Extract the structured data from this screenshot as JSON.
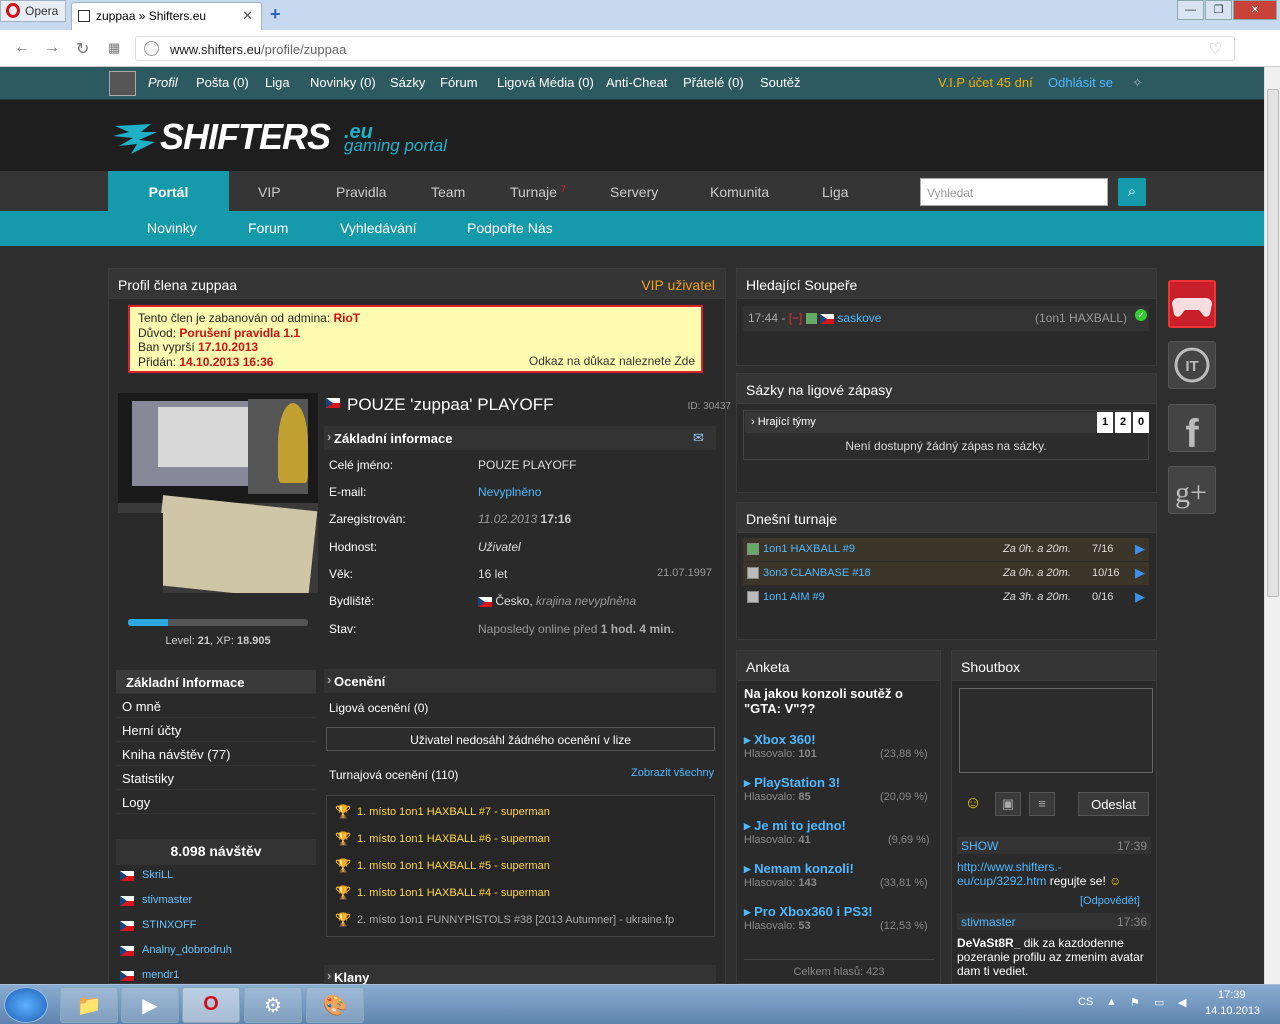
{
  "browser": {
    "menu_label": "Opera",
    "tab_title": "zuppaa » Shifters.eu",
    "url_host": "www.shifters.eu",
    "url_path": "/profile/zuppaa"
  },
  "topbar": {
    "items": [
      "Profil",
      "Pošta (0)",
      "Liga",
      "Novinky (0)",
      "Sázky",
      "Fórum",
      "Ligová Média (0)",
      "Anti-Cheat",
      "Přátelé (0)",
      "Soutěž"
    ],
    "vip": "V.I.P účet",
    "vip_days": "45 dní",
    "logout": "Odhlásit se"
  },
  "logo": {
    "text": "SHIFTERS",
    "eu": ".eu",
    "sub": "gaming portal"
  },
  "mainnav": {
    "items": [
      "Portál",
      "VIP",
      "Pravidla",
      "Team",
      "Turnaje",
      "Servery",
      "Komunita",
      "Liga"
    ],
    "turnaje_badge": "7",
    "search_placeholder": "Vyhledat"
  },
  "subnav": {
    "items": [
      "Novinky",
      "Forum",
      "Vyhledávání",
      "Podpořte Nás"
    ]
  },
  "profile": {
    "panel_title": "Profil člena zuppaa",
    "vip_badge": "VIP uživatel",
    "ban": {
      "l1": "Tento člen je zabanován od admina: ",
      "admin": "RioT",
      "l2": "Důvod: ",
      "reason": "Porušení pravidla 1.1",
      "l3": "Ban vyprší ",
      "expires": "17.10.2013",
      "l4": "Přidán: ",
      "added": "14.10.2013 16:36",
      "proof": "Odkaz na důkaz naleznete Zde"
    },
    "name": "POUZE 'zuppaa' PLAYOFF",
    "id": "ID: 30437",
    "xp_fraction": 0.22,
    "level_label": "Level: ",
    "level": "21",
    "xp_label": ", XP: ",
    "xp": "18.905",
    "sections": {
      "basic": "Základní informace",
      "awards": "Ocenění",
      "clans": "Klany"
    },
    "info": [
      {
        "label": "Celé jméno:",
        "value": "POUZE PLAYOFF"
      },
      {
        "label": "E-mail:",
        "value": "Nevyplněno"
      },
      {
        "label": "Zaregistrován:",
        "value": "11.02.2013",
        "value2": "17:16"
      },
      {
        "label": "Hodnost:",
        "value": "Uživatel"
      },
      {
        "label": "Věk:",
        "value": "16 let",
        "value2": "21.07.1997"
      },
      {
        "label": "Bydliště:",
        "value": "Česko,",
        "value2": "krajina nevyplněna"
      },
      {
        "label": "Stav:",
        "value": "Naposledy online před",
        "value2": "1 hod. 4 min."
      }
    ],
    "menu": [
      "Základní Informace",
      "O mně",
      "Herní účty",
      "Kniha návštěv (77)",
      "Statistiky",
      "Logy"
    ],
    "visits": "8.098 návštěv",
    "visitors": [
      "SkriLL",
      "stivmaster",
      "STINXOFF",
      "Analny_dobrodruh",
      "mendr1"
    ],
    "league_awards": "Ligová ocenění (0)",
    "no_award": "Uživatel nedosáhl žádného ocenění v lize",
    "tourney_awards": "Turnajová ocenění (110)",
    "show_all": "Zobrazit všechny",
    "awards": [
      "1. místo 1on1 HAXBALL #7 - superman",
      "1. místo 1on1 HAXBALL #6 - superman",
      "1. místo 1on1 HAXBALL #5 - superman",
      "1. místo 1on1 HAXBALL #4 - superman",
      "2. místo 1on1 FUNNYPISTOLS #38 [2013 Autumner] - ukraine.fp"
    ]
  },
  "opponents": {
    "title": "Hledající Soupeře",
    "time": "17:44 - ",
    "minus": "[−]",
    "user": "saskove",
    "game": "(1on1 HAXBALL)"
  },
  "bets": {
    "title": "Sázky na ligové zápasy",
    "head": "Hrající týmy",
    "n1": "1",
    "n2": "2",
    "n3": "0",
    "empty": "Není dostupný žádný zápas na sázky."
  },
  "tourneys": {
    "title": "Dnešní turnaje",
    "items": [
      {
        "name": "1on1 HAXBALL #9",
        "time": "Za 0h. a 20m.",
        "count": "7/16"
      },
      {
        "name": "3on3 CLANBASE #18",
        "time": "Za 0h. a 20m.",
        "count": "10/16"
      },
      {
        "name": "1on1 AIM #9",
        "time": "Za 3h. a 20m.",
        "count": "0/16"
      }
    ]
  },
  "poll": {
    "title": "Anketa",
    "question": "Na jakou konzoli soutěž o \"GTA: V\"??",
    "options": [
      {
        "label": "Xbox 360!",
        "votes": "Hlasovalo: ",
        "n": "101",
        "pct": "(23,88 %)"
      },
      {
        "label": "PlayStation 3!",
        "votes": "Hlasovalo: ",
        "n": "85",
        "pct": "(20,09 %)"
      },
      {
        "label": "Je mi to jedno!",
        "votes": "Hlasovalo: ",
        "n": "41",
        "pct": "(9,69 %)"
      },
      {
        "label": "Nemam konzoli!",
        "votes": "Hlasovalo: ",
        "n": "143",
        "pct": "(33,81 %)"
      },
      {
        "label": "Pro Xbox360 i PS3!",
        "votes": "Hlasovalo: ",
        "n": "53",
        "pct": "(12,53 %)"
      }
    ],
    "total": "Celkem hlasů: 423"
  },
  "shoutbox": {
    "title": "Shoutbox",
    "send": "Odeslat",
    "msg1": {
      "user": "SHOW",
      "time": "17:39",
      "link": "http://www.shifters.-eu/cup/3292.htm",
      "text": " regujte se!",
      "reply": "[Odpovědět]"
    },
    "msg2": {
      "user": "stivmaster",
      "time": "17:36",
      "author": "DeVaSt8R_",
      "text": " dik za kazdodenne pozeranie profilu az zmenim avatar dam ti vediet."
    }
  },
  "taskbar": {
    "lang": "CS",
    "time": "17:39",
    "date": "14.10.2013"
  },
  "colors": {
    "accent": "#149aaa",
    "topbar": "#2d5a60",
    "link": "#4fb8ff",
    "vip": "#f0a020"
  }
}
